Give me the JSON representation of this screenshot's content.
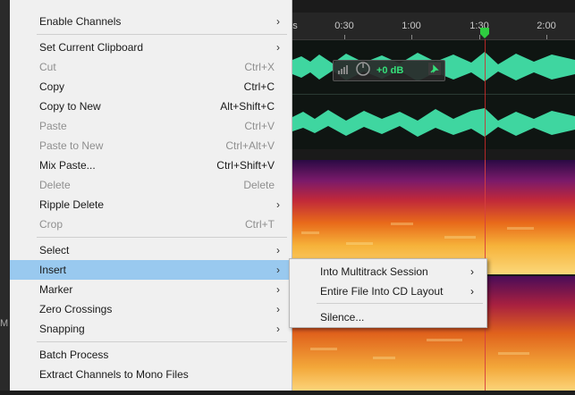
{
  "timeline": {
    "ticks": [
      "s",
      "0:30",
      "1:00",
      "1:30",
      "2:00"
    ]
  },
  "hud": {
    "gain": "+0 dB",
    "knob_icon": "volume-knob-icon",
    "meter_icon": "level-meter-icon",
    "pin_icon": "pin-icon"
  },
  "left_edge_text": "M",
  "menu": {
    "items": [
      {
        "label": "Enable Channels",
        "shortcut": "",
        "submenu": true,
        "disabled": false
      },
      {
        "label": "Set Current Clipboard",
        "shortcut": "",
        "submenu": true,
        "disabled": false
      },
      {
        "label": "Cut",
        "shortcut": "Ctrl+X",
        "submenu": false,
        "disabled": true
      },
      {
        "label": "Copy",
        "shortcut": "Ctrl+C",
        "submenu": false,
        "disabled": false
      },
      {
        "label": "Copy to New",
        "shortcut": "Alt+Shift+C",
        "submenu": false,
        "disabled": false
      },
      {
        "label": "Paste",
        "shortcut": "Ctrl+V",
        "submenu": false,
        "disabled": true
      },
      {
        "label": "Paste to New",
        "shortcut": "Ctrl+Alt+V",
        "submenu": false,
        "disabled": true
      },
      {
        "label": "Mix Paste...",
        "shortcut": "Ctrl+Shift+V",
        "submenu": false,
        "disabled": false
      },
      {
        "label": "Delete",
        "shortcut": "Delete",
        "submenu": false,
        "disabled": true
      },
      {
        "label": "Ripple Delete",
        "shortcut": "",
        "submenu": true,
        "disabled": false
      },
      {
        "label": "Crop",
        "shortcut": "Ctrl+T",
        "submenu": false,
        "disabled": true
      },
      {
        "label": "Select",
        "shortcut": "",
        "submenu": true,
        "disabled": false
      },
      {
        "label": "Insert",
        "shortcut": "",
        "submenu": true,
        "disabled": false,
        "highlighted": true
      },
      {
        "label": "Marker",
        "shortcut": "",
        "submenu": true,
        "disabled": false
      },
      {
        "label": "Zero Crossings",
        "shortcut": "",
        "submenu": true,
        "disabled": false
      },
      {
        "label": "Snapping",
        "shortcut": "",
        "submenu": true,
        "disabled": false
      },
      {
        "label": "Batch Process",
        "shortcut": "",
        "submenu": false,
        "disabled": false
      },
      {
        "label": "Extract Channels to Mono Files",
        "shortcut": "",
        "submenu": false,
        "disabled": false
      }
    ],
    "arrow_glyph": "›"
  },
  "submenu": {
    "items": [
      {
        "label": "Into Multitrack Session",
        "submenu": true
      },
      {
        "label": "Entire File Into CD Layout",
        "submenu": true
      },
      {
        "label": "Silence...",
        "submenu": false
      }
    ]
  },
  "colors": {
    "menu_bg": "#f0f0f0",
    "highlight": "#99c9ef",
    "waveform": "#3fd6a0",
    "playhead": "#d12a2a",
    "playhead_marker": "#2ecc40"
  }
}
